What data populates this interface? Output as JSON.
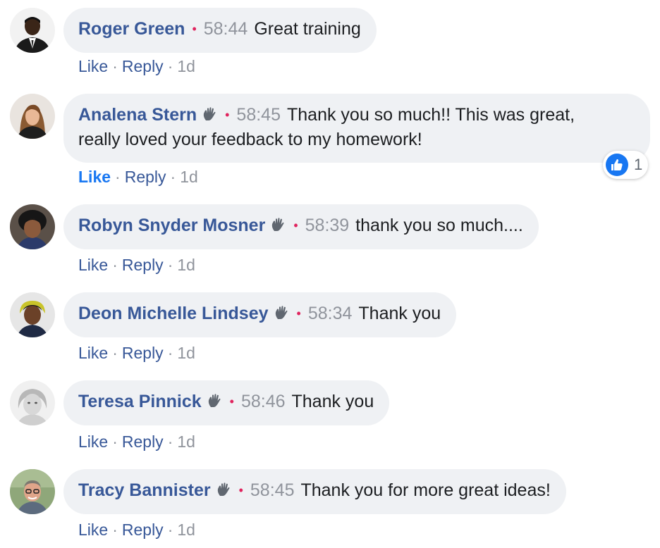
{
  "colors": {
    "author": "#385898",
    "bubble": "#eff1f4",
    "separator": "#e0245e",
    "meta": "#90949c",
    "like_active": "#1877f2"
  },
  "icons": {
    "wave": "wave-icon",
    "like_reaction": "thumbs-up-icon"
  },
  "actions": {
    "like": "Like",
    "reply": "Reply",
    "separator": "·"
  },
  "comments": [
    {
      "author": "Roger Green",
      "badge": false,
      "time": "58:44",
      "text": "Great training",
      "age": "1d",
      "liked": false
    },
    {
      "author": "Analena Stern",
      "badge": true,
      "time": "58:45",
      "text_line1": "Thank you so much!! This was great,",
      "text_line2": "really loved your feedback to my homework!",
      "age": "1d",
      "liked": true,
      "reaction_count": "1"
    },
    {
      "author": "Robyn Snyder Mosner",
      "badge": true,
      "time": "58:39",
      "text": "thank you so much....",
      "age": "1d",
      "liked": false
    },
    {
      "author": "Deon Michelle Lindsey",
      "badge": true,
      "time": "58:34",
      "text": "Thank you",
      "age": "1d",
      "liked": false
    },
    {
      "author": "Teresa Pinnick",
      "badge": true,
      "time": "58:46",
      "text": "Thank you",
      "age": "1d",
      "liked": false
    },
    {
      "author": "Tracy Bannister",
      "badge": true,
      "time": "58:45",
      "text": "Thank you for more great ideas!",
      "age": "1d",
      "liked": false
    }
  ]
}
